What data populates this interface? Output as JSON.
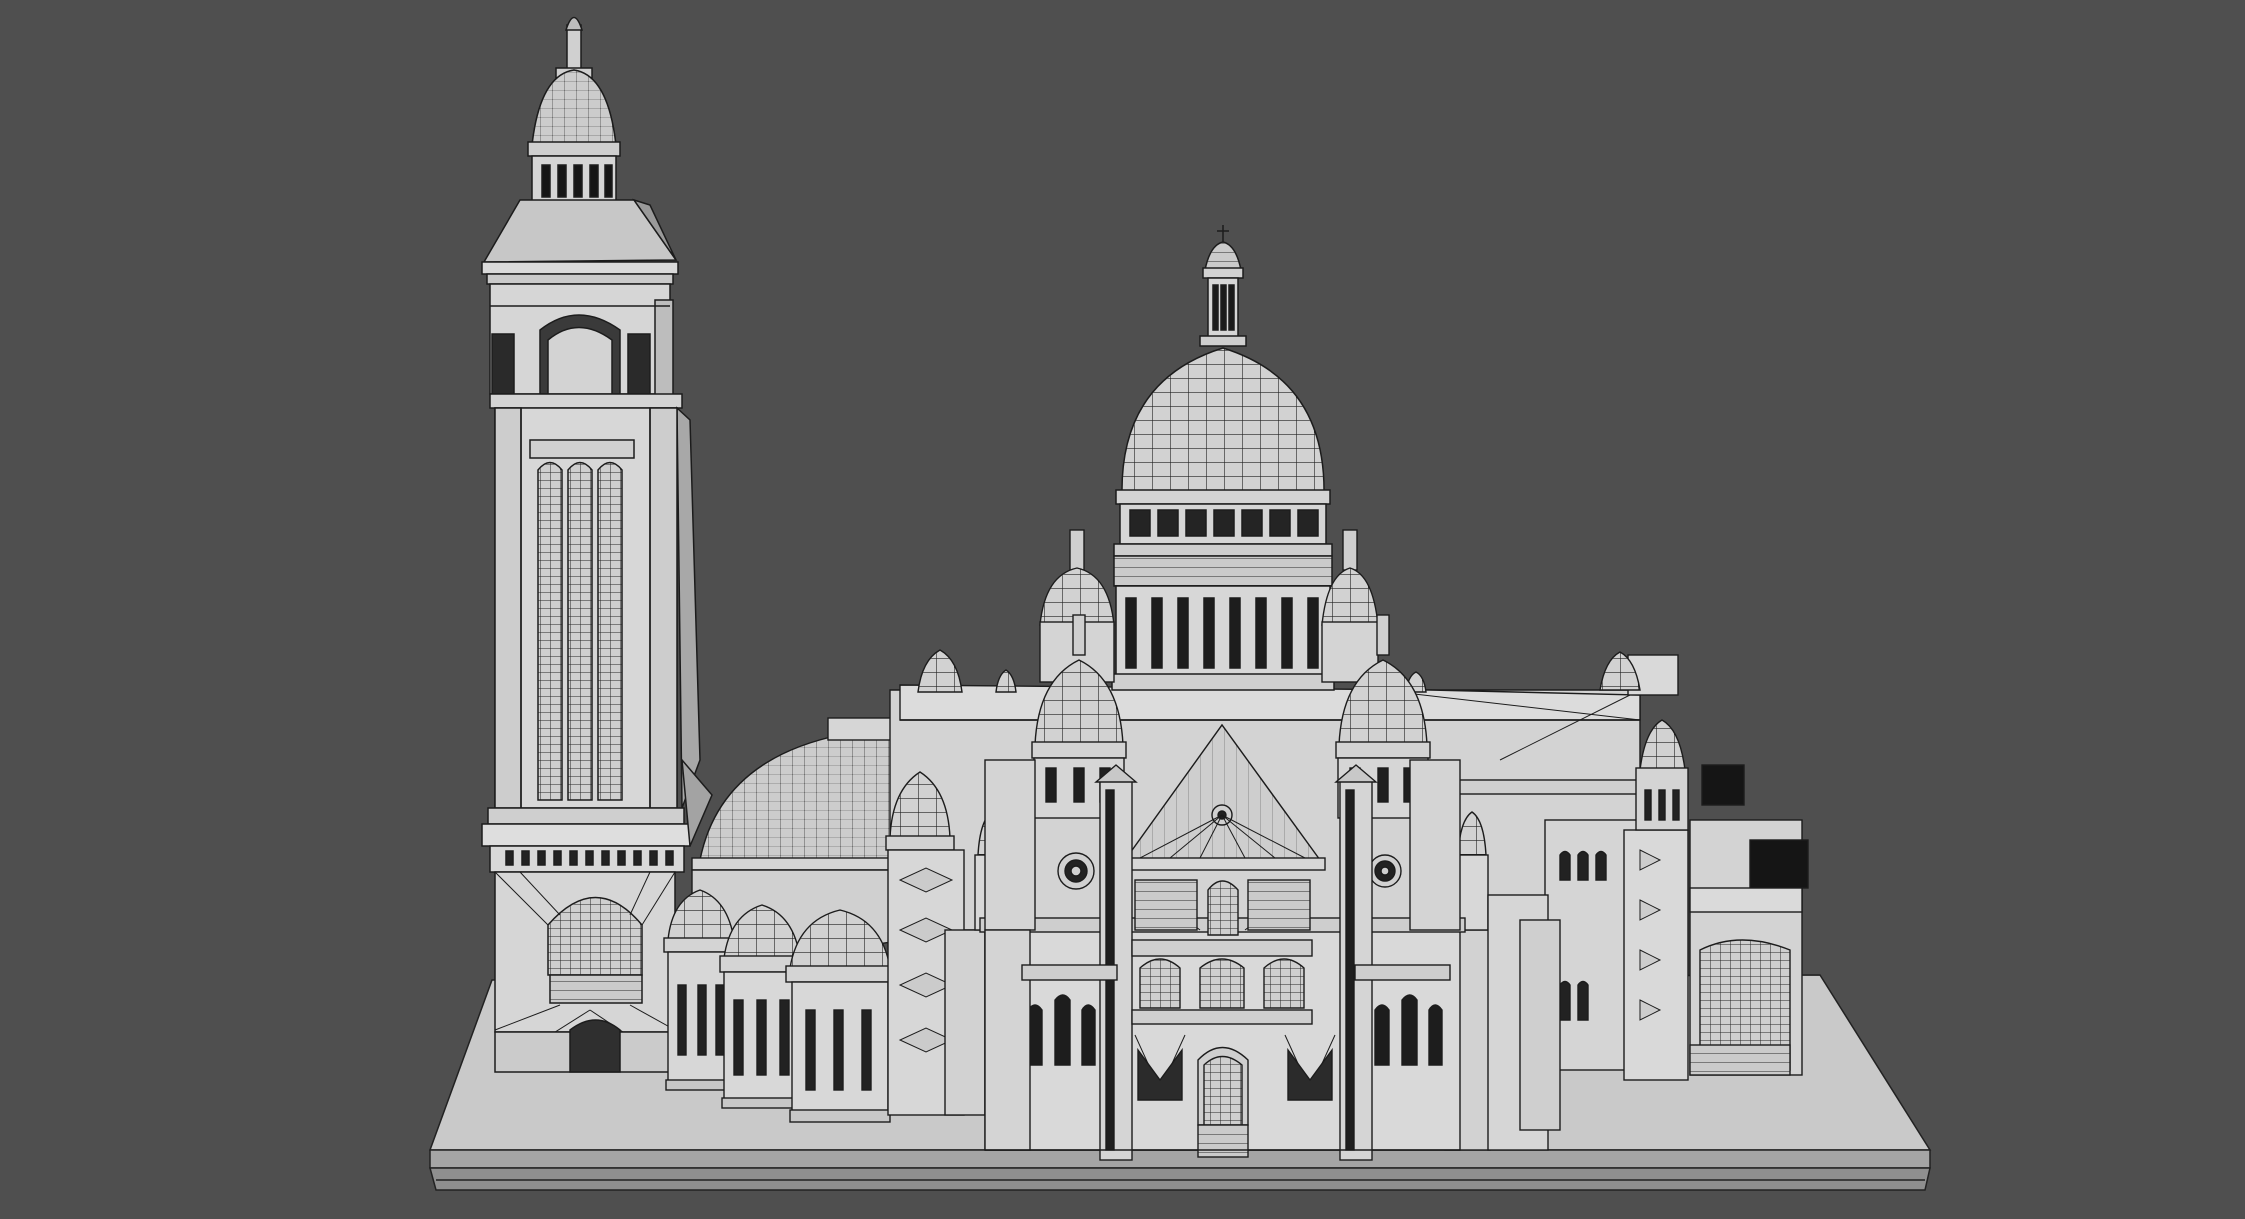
{
  "scene": {
    "background_color": "#4f4f4f",
    "model_fill": "#d8d8d8",
    "model_shade": "#c4c4c4",
    "model_dark": "#a9a9a9",
    "wire_color": "#1c1c1c",
    "opening_color": "#111111",
    "render_style": "wireframe-on-shaded",
    "subject": "domed-basilica-3d-model"
  }
}
